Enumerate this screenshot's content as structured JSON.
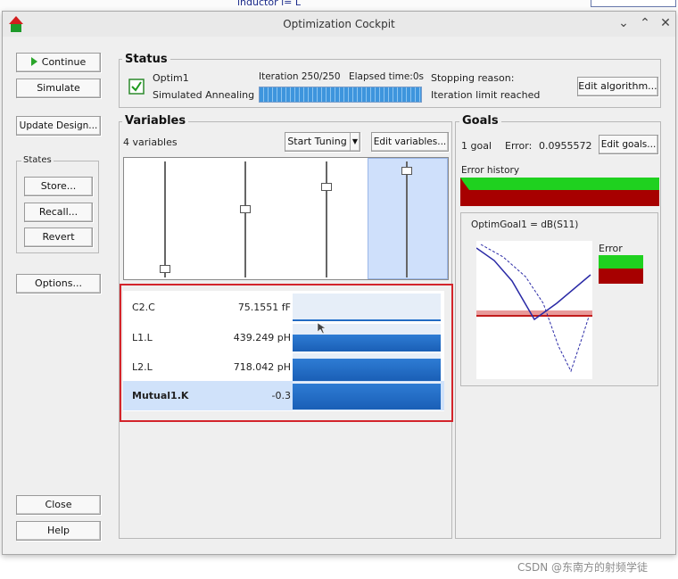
{
  "background_text": {
    "top_label": "inductor l= L"
  },
  "window": {
    "title": "Optimization Cockpit",
    "controls": [
      "⌄",
      "⌃",
      "✕"
    ]
  },
  "left_buttons": {
    "continue": "Continue",
    "simulate": "Simulate",
    "update_design": "Update Design...",
    "states_label": "States",
    "store": "Store...",
    "recall": "Recall...",
    "revert": "Revert",
    "options": "Options...",
    "close": "Close",
    "help": "Help"
  },
  "status": {
    "title": "Status",
    "optim_name": "Optim1",
    "algorithm": "Simulated Annealing",
    "iteration": "Iteration 250/250",
    "elapsed": "Elapsed time:0s",
    "progress": 1.0,
    "stopping_label": "Stopping reason:",
    "stopping_reason": "Iteration limit reached",
    "edit_algorithm": "Edit algorithm..."
  },
  "variables": {
    "title": "Variables",
    "count": "4 variables",
    "start_tuning": "Start Tuning",
    "edit_variables": "Edit variables...",
    "slider_levels": [
      0.05,
      0.6,
      0.8,
      0.95
    ],
    "rows": [
      {
        "name": "C2.C",
        "value": "75.1551 fF",
        "fill": 0.05
      },
      {
        "name": "L1.L",
        "value": "439.249 pH",
        "fill": 0.6
      },
      {
        "name": "L2.L",
        "value": "718.042 pH",
        "fill": 0.8
      },
      {
        "name": "Mutual1.K",
        "value": "-0.3",
        "fill": 0.95
      }
    ]
  },
  "goals": {
    "title": "Goals",
    "count": "1 goal",
    "error_label": "Error:",
    "error_value": "0.0955572",
    "edit_goals": "Edit goals...",
    "error_history_label": "Error history",
    "graph_title": "OptimGoal1 = dB(S11)",
    "legend_label": "Error"
  },
  "colors": {
    "accent": "#2e7cd4",
    "green": "#1fd11f",
    "red": "#a70000",
    "highlight": "#d3242b"
  },
  "watermark": "CSDN @东南方的射频学徒"
}
